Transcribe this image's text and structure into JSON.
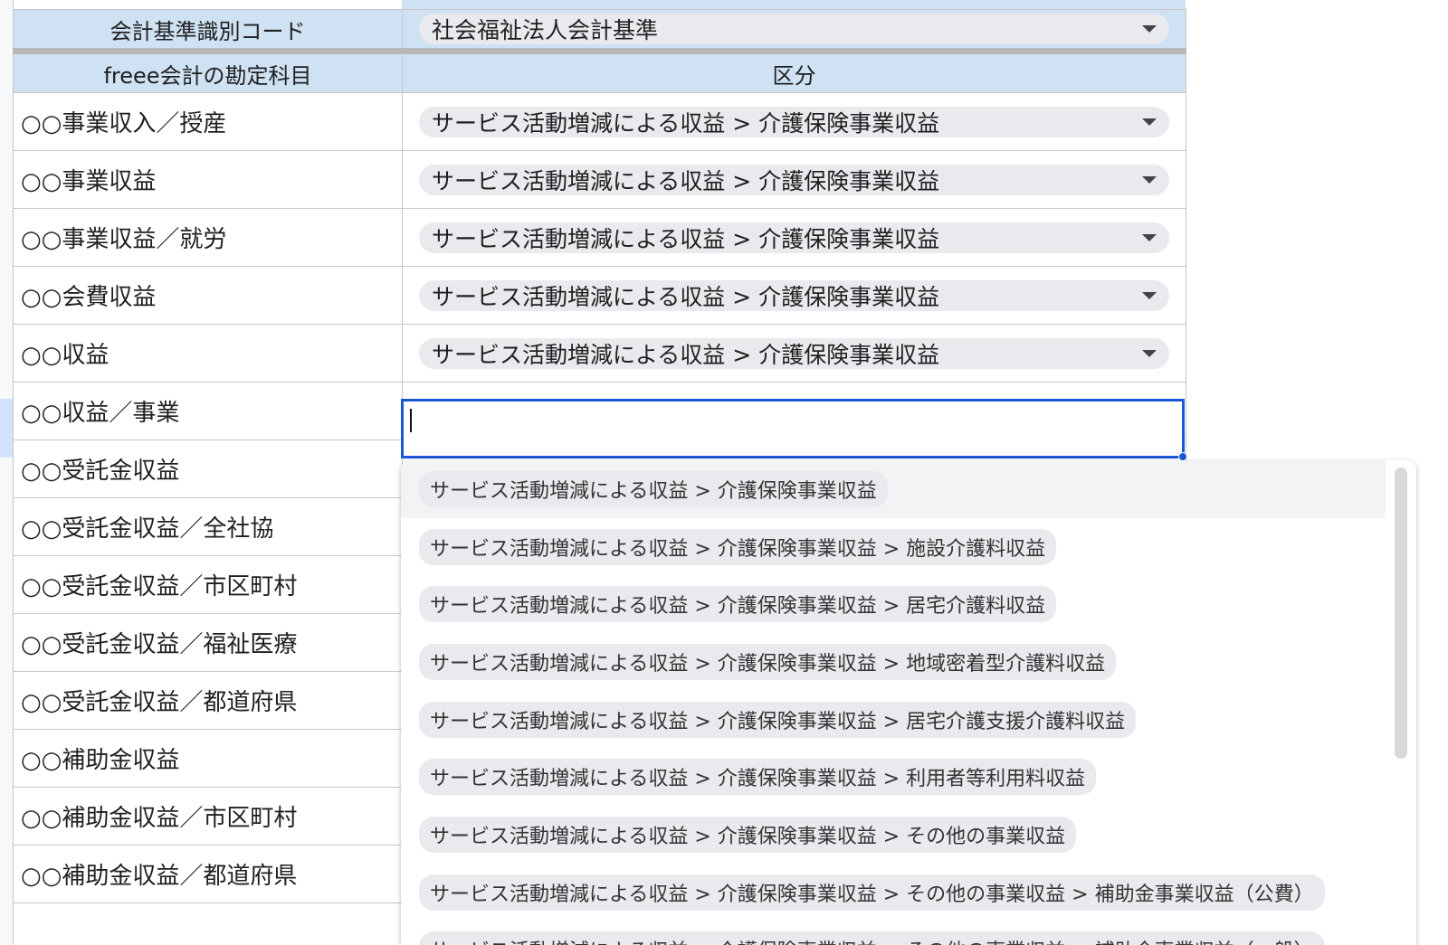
{
  "header": {
    "code_label": "会計基準識別コード",
    "code_value": "社会福祉法人会計基準",
    "col_account": "freee会計の勘定科目",
    "col_category": "区分"
  },
  "rows": [
    {
      "account": "○○事業収入／授産",
      "category": "サービス活動増減による収益 > 介護保険事業収益"
    },
    {
      "account": "○○事業収益",
      "category": "サービス活動増減による収益 > 介護保険事業収益"
    },
    {
      "account": "○○事業収益／就労",
      "category": "サービス活動増減による収益 > 介護保険事業収益"
    },
    {
      "account": "○○会費収益",
      "category": "サービス活動増減による収益 > 介護保険事業収益"
    },
    {
      "account": "○○収益",
      "category": "サービス活動増減による収益 > 介護保険事業収益"
    },
    {
      "account": "○○収益／事業",
      "category": ""
    },
    {
      "account": "○○受託金収益",
      "category": ""
    },
    {
      "account": "○○受託金収益／全社協",
      "category": ""
    },
    {
      "account": "○○受託金収益／市区町村",
      "category": ""
    },
    {
      "account": "○○受託金収益／福祉医療",
      "category": ""
    },
    {
      "account": "○○受託金収益／都道府県",
      "category": ""
    },
    {
      "account": "○○補助金収益",
      "category": ""
    },
    {
      "account": "○○補助金収益／市区町村",
      "category": ""
    },
    {
      "account": "○○補助金収益／都道府県",
      "category": ""
    }
  ],
  "editor": {
    "value": ""
  },
  "dropdown": {
    "options": [
      "サービス活動増減による収益 > 介護保険事業収益",
      "サービス活動増減による収益 > 介護保険事業収益 > 施設介護料収益",
      "サービス活動増減による収益 > 介護保険事業収益 > 居宅介護料収益",
      "サービス活動増減による収益 > 介護保険事業収益 > 地域密着型介護料収益",
      "サービス活動増減による収益 > 介護保険事業収益 > 居宅介護支援介護料収益",
      "サービス活動増減による収益 > 介護保険事業収益 > 利用者等利用料収益",
      "サービス活動増減による収益 > 介護保険事業収益 > その他の事業収益",
      "サービス活動増減による収益 > 介護保険事業収益 > その他の事業収益 > 補助金事業収益（公費）",
      "サービス活動増減による収益 > 介護保険事業収益 > その他の事業収益 > 補助金事業収益（一般）"
    ]
  }
}
